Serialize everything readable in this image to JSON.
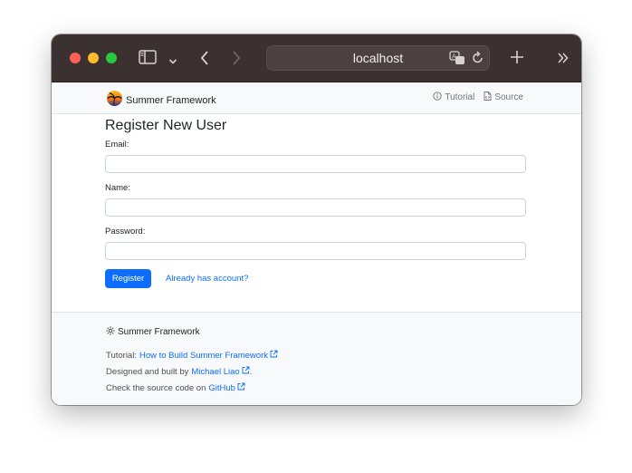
{
  "browser": {
    "url": "localhost"
  },
  "navbar": {
    "brand": "Summer Framework",
    "tutorial": "Tutorial",
    "source": "Source"
  },
  "form": {
    "title": "Register New User",
    "email_label": "Email:",
    "email_value": "",
    "name_label": "Name:",
    "name_value": "",
    "password_label": "Password:",
    "password_value": "",
    "submit_label": "Register",
    "signin_link": "Already has account?"
  },
  "footer": {
    "brand": "Summer Framework",
    "tutorial_prefix": "Tutorial:",
    "tutorial_link": "How to Build Summer Framework",
    "designed_prefix": "Designed and built by",
    "designed_link": "Michael Liao",
    "designed_suffix": ".",
    "source_prefix": "Check the source code on",
    "source_link": "GitHub"
  },
  "colors": {
    "accent": "#0d6efd",
    "titlebar": "#3a3130",
    "page_bg": "#f8f9fa"
  }
}
